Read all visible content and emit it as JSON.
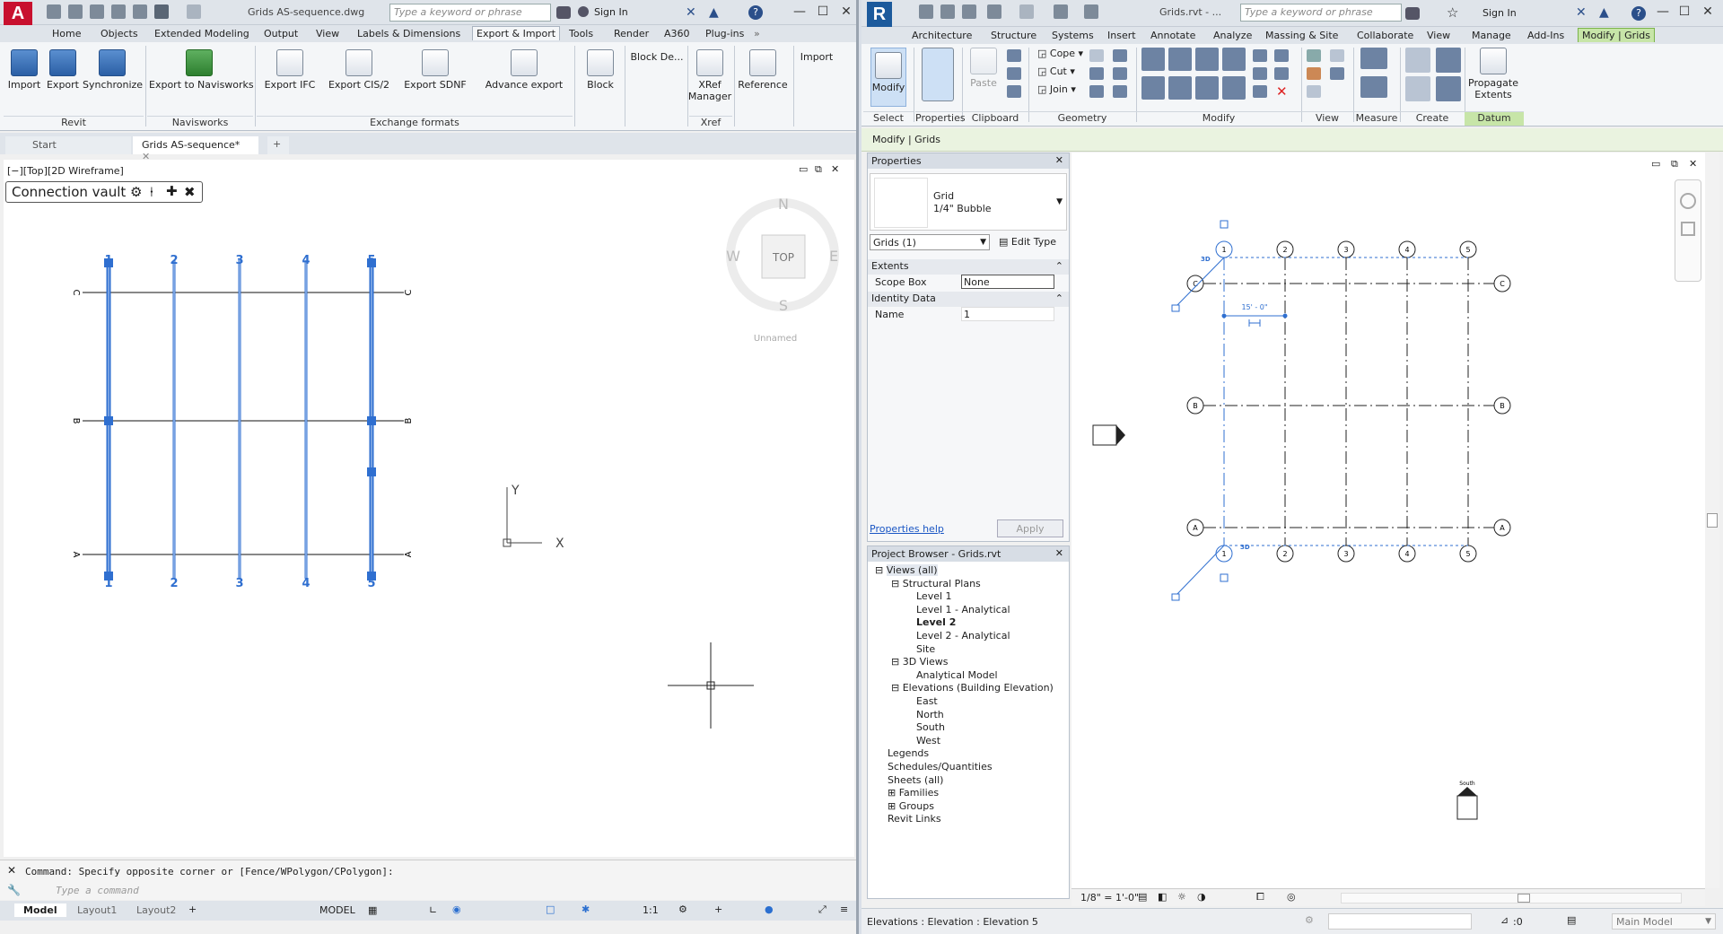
{
  "acad": {
    "title": "Grids AS-sequence.dwg",
    "search_placeholder": "Type a keyword or phrase",
    "sign_in": "Sign In",
    "tabs": [
      "Home",
      "Objects",
      "Extended Modeling",
      "Output",
      "View",
      "Labels & Dimensions",
      "Export & Import",
      "Tools",
      "Render",
      "A360",
      "Plug-ins"
    ],
    "ribbon": {
      "import": "Import",
      "export": "Export",
      "synchronize": "Synchronize",
      "export_navisworks": "Export to Navisworks",
      "export_ifc": "Export IFC",
      "export_cis2": "Export CIS/2",
      "export_sdnf": "Export SDNF",
      "advance_export": "Advance export",
      "block": "Block",
      "block_de": "Block De...",
      "xref_manager_1": "XRef",
      "xref_manager_2": "Manager",
      "reference": "Reference",
      "import2": "Import",
      "panel_revit": "Revit",
      "panel_navisworks": "Navisworks",
      "panel_exchange": "Exchange formats",
      "panel_xref": "Xref"
    },
    "doc_tabs": {
      "start": "Start",
      "active": "Grids AS-sequence*"
    },
    "viewport_label": "[−][Top][2D Wireframe]",
    "connection_vault": "Connection vault",
    "viewcube": {
      "n": "N",
      "s": "S",
      "e": "E",
      "w": "W",
      "top": "TOP",
      "unnamed": "Unnamed"
    },
    "grid_numbers": [
      "1",
      "2",
      "3",
      "4",
      "5"
    ],
    "grid_letters": [
      "C",
      "B",
      "A"
    ],
    "ucs": {
      "x": "X",
      "y": "Y"
    },
    "command_history": "Command: Specify opposite corner or [Fence/WPolygon/CPolygon]:",
    "command_placeholder": "Type a command",
    "layout_tabs": [
      "Model",
      "Layout1",
      "Layout2"
    ],
    "status_model": "MODEL",
    "scale": "1:1"
  },
  "revit": {
    "title": "Grids.rvt - ...",
    "search_placeholder": "Type a keyword or phrase",
    "sign_in": "Sign In",
    "tabs": [
      "Architecture",
      "Structure",
      "Systems",
      "Insert",
      "Annotate",
      "Analyze",
      "Massing & Site",
      "Collaborate",
      "View",
      "Manage",
      "Add-Ins",
      "Modify | Grids"
    ],
    "ribbon": {
      "modify": "Modify",
      "paste": "Paste",
      "cope": "Cope",
      "cut": "Cut",
      "join": "Join",
      "propagate_1": "Propagate",
      "propagate_2": "Extents",
      "panel_select": "Select",
      "panel_properties": "Properties",
      "panel_clipboard": "Clipboard",
      "panel_geometry": "Geometry",
      "panel_modify": "Modify",
      "panel_view": "View",
      "panel_measure": "Measure",
      "panel_create": "Create",
      "panel_datum": "Datum"
    },
    "context_bar": "Modify | Grids",
    "properties": {
      "header": "Properties",
      "type_line1": "Grid",
      "type_line2": "1/4\" Bubble",
      "selector": "Grids (1)",
      "edit_type": "Edit Type",
      "extents": "Extents",
      "scope_box_label": "Scope Box",
      "scope_box_value": "None",
      "identity": "Identity Data",
      "name_label": "Name",
      "name_value": "1",
      "help": "Properties help",
      "apply": "Apply"
    },
    "browser": {
      "header": "Project Browser - Grids.rvt",
      "items": [
        "Views (all)",
        "Structural Plans",
        "Level 1",
        "Level 1 - Analytical",
        "Level 2",
        "Level 2 - Analytical",
        "Site",
        "3D Views",
        "Analytical Model",
        "Elevations (Building Elevation)",
        "East",
        "North",
        "South",
        "West",
        "Legends",
        "Schedules/Quantities",
        "Sheets (all)",
        "Families",
        "Groups",
        "Revit Links"
      ]
    },
    "grid_numbers": [
      "1",
      "2",
      "3",
      "4",
      "5"
    ],
    "grid_letters": [
      "C",
      "B",
      "A"
    ],
    "dimension": "15' - 0\"",
    "label_3d": "3D",
    "south_label": "South",
    "view_scale": "1/8\" = 1'-0\"",
    "status_text": "Elevations : Elevation : Elevation 5",
    "status_zero": ":0",
    "workset": "Main Model"
  }
}
